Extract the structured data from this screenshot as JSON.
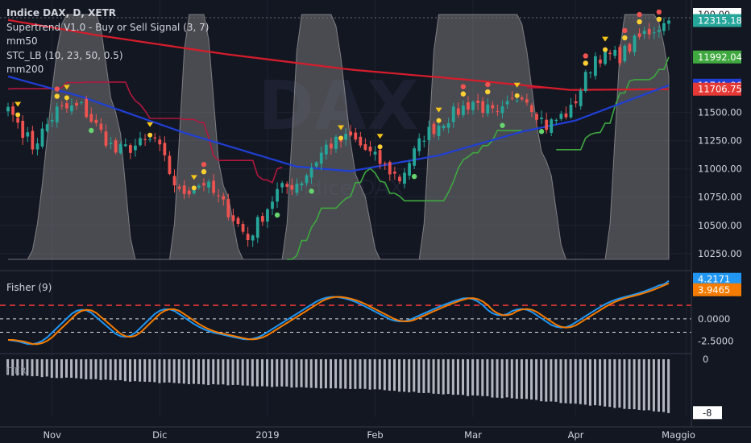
{
  "header": {
    "title": "Indice DAX, D, XETR",
    "indicators": [
      "Supertrend V1.0 - Buy or Sell Signal (3, 7)",
      "mm50",
      "STC_LB (10, 23, 50, 0.5)",
      "mm200"
    ]
  },
  "watermark": {
    "symbol": "DAX",
    "name": "Indice DAX"
  },
  "fisher_pane": {
    "label": "Fisher (9)"
  },
  "iter_pane": {
    "label": "ITER"
  },
  "price_axis": {
    "ticks": [
      "100.00",
      "12315.18",
      "11992.04",
      "11741.86",
      "11706.75",
      "11500.00",
      "11250.00",
      "11000.00",
      "10750.00",
      "10500.00",
      "10250.00"
    ]
  },
  "fisher_axis": {
    "ticks": [
      "4.2171",
      "3.9465",
      "0.0000",
      "-2.5000"
    ]
  },
  "iter_axis": {
    "ticks": [
      "0",
      "-8"
    ]
  },
  "time_axis": {
    "labels": [
      "Nov",
      "Dic",
      "2019",
      "Feb",
      "Mar",
      "Apr",
      "Maggio"
    ]
  },
  "colors": {
    "background": "#131722",
    "bull": "#26a69a",
    "bear": "#ef5350",
    "mm50": "#1f3fd6",
    "mm200": "#d91c2b",
    "supertrend_up": "#3fa83f",
    "supertrend_down": "#b2173e",
    "stc": "#8c8c8c",
    "fisher": "#2196f3",
    "fisher_trigger": "#f57c00",
    "iter": "#b2b5be"
  },
  "chart_data": [
    {
      "type": "candlestick",
      "title": "Indice DAX, D, XETR",
      "ylim": [
        10170,
        12440
      ],
      "x_period": [
        "2018-10-19",
        "2019-04-26"
      ],
      "ohlc_anchors": [
        {
          "date": "2018-10-19",
          "close": 11550
        },
        {
          "date": "2018-10-26",
          "close": 11200
        },
        {
          "date": "2018-11-02",
          "close": 11520
        },
        {
          "date": "2018-11-09",
          "close": 11550
        },
        {
          "date": "2018-11-20",
          "close": 11150
        },
        {
          "date": "2018-11-30",
          "close": 11260
        },
        {
          "date": "2018-12-07",
          "close": 10780
        },
        {
          "date": "2018-12-14",
          "close": 10880
        },
        {
          "date": "2018-12-21",
          "close": 10630
        },
        {
          "date": "2018-12-27",
          "close": 10380
        },
        {
          "date": "2019-01-04",
          "close": 10800
        },
        {
          "date": "2019-01-11",
          "close": 10900
        },
        {
          "date": "2019-01-18",
          "close": 11200
        },
        {
          "date": "2019-01-25",
          "close": 11280
        },
        {
          "date": "2019-02-08",
          "close": 10910
        },
        {
          "date": "2019-02-15",
          "close": 11300
        },
        {
          "date": "2019-02-22",
          "close": 11460
        },
        {
          "date": "2019-03-01",
          "close": 11600
        },
        {
          "date": "2019-03-08",
          "close": 11460
        },
        {
          "date": "2019-03-15",
          "close": 11680
        },
        {
          "date": "2019-03-22",
          "close": 11380
        },
        {
          "date": "2019-03-29",
          "close": 11520
        },
        {
          "date": "2019-04-05",
          "close": 12000
        },
        {
          "date": "2019-04-12",
          "close": 12000
        },
        {
          "date": "2019-04-19",
          "close": 12200
        },
        {
          "date": "2019-04-26",
          "close": 12315
        }
      ],
      "last_values": {
        "close": 12315.18,
        "supertrend": 11992.04,
        "mm50": 11741.86,
        "mm200": 11706.75,
        "stc": 100.0
      },
      "series": [
        {
          "name": "mm50",
          "type": "line",
          "color": "#1f3fd6"
        },
        {
          "name": "mm200",
          "type": "line",
          "color": "#d91c2b"
        },
        {
          "name": "Supertrend V1.0 - Buy or Sell Signal (3, 7)",
          "type": "line",
          "color": "#3fa83f"
        },
        {
          "name": "STC_LB (10, 23, 50, 0.5)",
          "type": "area",
          "range": [
            0,
            100
          ],
          "color": "#8c8c8c"
        }
      ]
    },
    {
      "type": "line",
      "title": "Fisher (9)",
      "ylim": [
        -3.6,
        5.0
      ],
      "levels": [
        1.5,
        0.0,
        -1.5
      ],
      "series": [
        {
          "name": "Fisher",
          "color": "#2196f3",
          "last": 4.2171
        },
        {
          "name": "Trigger",
          "color": "#f57c00",
          "last": 3.9465
        }
      ],
      "anchors": [
        {
          "date": "2018-10-19",
          "value": -2.2
        },
        {
          "date": "2018-10-29",
          "value": -3.1
        },
        {
          "date": "2018-11-09",
          "value": 1.6
        },
        {
          "date": "2018-11-22",
          "value": -2.6
        },
        {
          "date": "2018-12-04",
          "value": 1.6
        },
        {
          "date": "2018-12-14",
          "value": -1.3
        },
        {
          "date": "2018-12-28",
          "value": -2.5
        },
        {
          "date": "2019-01-18",
          "value": 2.6
        },
        {
          "date": "2019-01-25",
          "value": 2.2
        },
        {
          "date": "2019-02-08",
          "value": -0.6
        },
        {
          "date": "2019-02-22",
          "value": 1.8
        },
        {
          "date": "2019-03-01",
          "value": 2.6
        },
        {
          "date": "2019-03-08",
          "value": -0.1
        },
        {
          "date": "2019-03-15",
          "value": 1.5
        },
        {
          "date": "2019-03-27",
          "value": -1.4
        },
        {
          "date": "2019-04-10",
          "value": 2.0
        },
        {
          "date": "2019-04-19",
          "value": 3.0
        },
        {
          "date": "2019-04-26",
          "value": 4.2
        }
      ]
    },
    {
      "type": "bar",
      "title": "ITER",
      "ylim": [
        -8,
        0
      ],
      "anchors": [
        {
          "date": "2018-10-19",
          "value": -2.5
        },
        {
          "date": "2018-12-07",
          "value": -3.6
        },
        {
          "date": "2019-02-01",
          "value": -4.4
        },
        {
          "date": "2019-03-15",
          "value": -5.6
        },
        {
          "date": "2019-04-26",
          "value": -7.4
        }
      ]
    }
  ]
}
